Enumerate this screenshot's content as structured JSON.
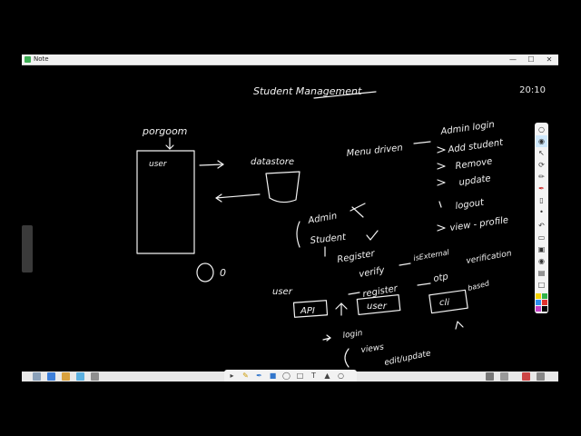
{
  "window": {
    "title": "Note",
    "controls": [
      "—",
      "☐",
      "✕"
    ]
  },
  "clock": "20:10",
  "notes": {
    "title": "Student Management",
    "program": "porgoom",
    "user_in_box": "user",
    "datastore": "datastore",
    "menu_driven": "Menu driven",
    "menu_items": [
      "Admin login",
      "Add student",
      "Remove",
      "update",
      "logout",
      "view - profile"
    ],
    "role_admin": "Admin",
    "role_student": "Student",
    "register": "Register",
    "verify": "verify",
    "is_external": "isExternal",
    "register2": "register",
    "otp": "otp",
    "verification": "verification",
    "user_label": "user",
    "api": "API",
    "user_box": "user",
    "cli": "cli",
    "based": "based",
    "login": "login",
    "views": "views",
    "edit_update": "edit/update",
    "circled_number": "0"
  },
  "toolbar_icons": [
    "lamp-icon",
    "eye-icon",
    "select-icon",
    "lasso-icon",
    "pen-icon",
    "marker-icon",
    "eraser-icon",
    "dot-icon",
    "undo-icon",
    "trash-icon",
    "image-icon",
    "camera-icon",
    "clipboard-icon",
    "page-icon"
  ],
  "palette": [
    "#f5d400",
    "#32b34a",
    "#2d8ff0",
    "#e0322e",
    "#c640c6",
    "#000000"
  ],
  "bottom_tools": [
    "pointer-icon",
    "pen-tool-icon",
    "highlighter-icon",
    "shape-icon",
    "ruler-icon",
    "text-icon",
    "hand-icon",
    "zoom-icon",
    "more-icon"
  ]
}
